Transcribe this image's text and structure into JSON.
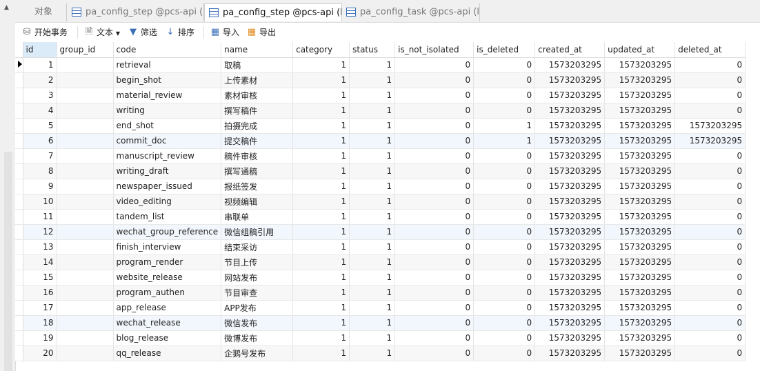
{
  "tabs": [
    {
      "label": "对象",
      "active": false
    },
    {
      "label": "pa_config_step @pcs-api (l...",
      "active": false
    },
    {
      "label": "pa_config_step @pcs-api (l...",
      "active": true
    },
    {
      "label": "pa_config_task @pcs-api (lo...",
      "active": false
    }
  ],
  "toolbar": {
    "begin_transaction": "开始事务",
    "text": "文本",
    "filter": "筛选",
    "sort": "排序",
    "import": "导入",
    "export": "导出"
  },
  "columns": [
    "id",
    "group_id",
    "code",
    "name",
    "category",
    "status",
    "is_not_isolated",
    "is_deleted",
    "created_at",
    "updated_at",
    "deleted_at"
  ],
  "rows": [
    [
      "1",
      "",
      "retrieval",
      "取稿",
      "1",
      "1",
      "0",
      "0",
      "1573203295",
      "1573203295",
      "0"
    ],
    [
      "2",
      "",
      "begin_shot",
      "上传素材",
      "1",
      "1",
      "0",
      "0",
      "1573203295",
      "1573203295",
      "0"
    ],
    [
      "3",
      "",
      "material_review",
      "素材审核",
      "1",
      "1",
      "0",
      "0",
      "1573203295",
      "1573203295",
      "0"
    ],
    [
      "4",
      "",
      "writing",
      "撰写稿件",
      "1",
      "1",
      "0",
      "0",
      "1573203295",
      "1573203295",
      "0"
    ],
    [
      "5",
      "",
      "end_shot",
      "拍摄完成",
      "1",
      "1",
      "0",
      "1",
      "1573203295",
      "1573203295",
      "1573203295"
    ],
    [
      "6",
      "",
      "commit_doc",
      "提交稿件",
      "1",
      "1",
      "0",
      "1",
      "1573203295",
      "1573203295",
      "1573203295"
    ],
    [
      "7",
      "",
      "manuscript_review",
      "稿件审核",
      "1",
      "1",
      "0",
      "0",
      "1573203295",
      "1573203295",
      "0"
    ],
    [
      "8",
      "",
      "writing_draft",
      "撰写通稿",
      "1",
      "1",
      "0",
      "0",
      "1573203295",
      "1573203295",
      "0"
    ],
    [
      "9",
      "",
      "newspaper_issued",
      "报纸签发",
      "1",
      "1",
      "0",
      "0",
      "1573203295",
      "1573203295",
      "0"
    ],
    [
      "10",
      "",
      "video_editing",
      "视频编辑",
      "1",
      "1",
      "0",
      "0",
      "1573203295",
      "1573203295",
      "0"
    ],
    [
      "11",
      "",
      "tandem_list",
      "串联单",
      "1",
      "1",
      "0",
      "0",
      "1573203295",
      "1573203295",
      "0"
    ],
    [
      "12",
      "",
      "wechat_group_reference",
      "微信组稿引用",
      "1",
      "1",
      "0",
      "0",
      "1573203295",
      "1573203295",
      "0"
    ],
    [
      "13",
      "",
      "finish_interview",
      "结束采访",
      "1",
      "1",
      "0",
      "0",
      "1573203295",
      "1573203295",
      "0"
    ],
    [
      "14",
      "",
      "program_render",
      "节目上传",
      "1",
      "1",
      "0",
      "0",
      "1573203295",
      "1573203295",
      "0"
    ],
    [
      "15",
      "",
      "website_release",
      "网站发布",
      "1",
      "1",
      "0",
      "0",
      "1573203295",
      "1573203295",
      "0"
    ],
    [
      "16",
      "",
      "program_authen",
      "节目审查",
      "1",
      "1",
      "0",
      "0",
      "1573203295",
      "1573203295",
      "0"
    ],
    [
      "17",
      "",
      "app_release",
      "APP发布",
      "1",
      "1",
      "0",
      "0",
      "1573203295",
      "1573203295",
      "0"
    ],
    [
      "18",
      "",
      "wechat_release",
      "微信发布",
      "1",
      "1",
      "0",
      "0",
      "1573203295",
      "1573203295",
      "0"
    ],
    [
      "19",
      "",
      "blog_release",
      "微博发布",
      "1",
      "1",
      "0",
      "0",
      "1573203295",
      "1573203295",
      "0"
    ],
    [
      "20",
      "",
      "qq_release",
      "企鹅号发布",
      "1",
      "1",
      "0",
      "0",
      "1573203295",
      "1573203295",
      "0"
    ]
  ]
}
